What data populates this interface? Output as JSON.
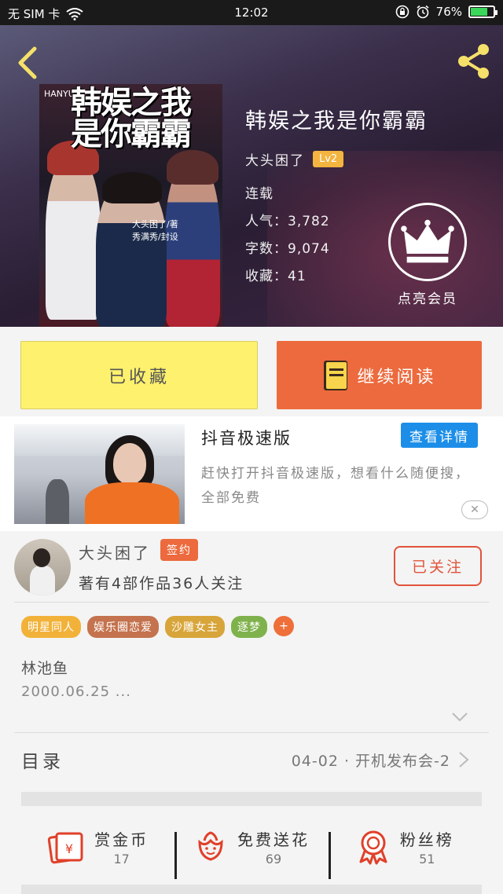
{
  "status_bar": {
    "carrier": "无 SIM 卡",
    "time": "12:02",
    "battery": "76%",
    "battery_level": 0.76
  },
  "book": {
    "title": "韩娱之我是你霸霸",
    "author": "大头困了",
    "level": "Lv2",
    "status": "连载",
    "popularity": "人气：3,782",
    "word_count": "字数：9,074",
    "favorites": "收藏：41",
    "cover": {
      "title_text": "韩娱之我是你霸霸",
      "brand": "HANYU",
      "author_credit": "大头困了/著",
      "designer_credit": "秀满秀/封设"
    }
  },
  "vip": {
    "label": "点亮会员"
  },
  "actions": {
    "collected": "已收藏",
    "continue_reading": "继续阅读"
  },
  "ad": {
    "title": "抖音极速版",
    "detail_button": "查看详情",
    "description": "赶快打开抖音极速版，想看什么随便搜，全部免费",
    "close": "✕"
  },
  "author_info": {
    "name": "大头困了",
    "badge": "签约",
    "stats": "著有4部作品36人关注",
    "follow_button": "已关注"
  },
  "tags": [
    {
      "label": "明星同人",
      "color": "#f2b23a"
    },
    {
      "label": "娱乐圈恋爱",
      "color": "#c4734e"
    },
    {
      "label": "沙雕女主",
      "color": "#d8a53a"
    },
    {
      "label": "逐梦",
      "color": "#7fb24c"
    }
  ],
  "tags_more": "+",
  "description": {
    "line1": "林池鱼",
    "line2": "2000.06.25 ..."
  },
  "toc": {
    "label": "目录",
    "latest": "04-02 · 开机发布会-2"
  },
  "rewards": [
    {
      "label": "赏金币",
      "count": "17",
      "icon": "red-envelope-icon"
    },
    {
      "label": "免费送花",
      "count": "69",
      "icon": "flower-icon"
    },
    {
      "label": "粉丝榜",
      "count": "51",
      "icon": "medal-icon"
    }
  ],
  "colors": {
    "accent_orange": "#ec6a3d",
    "collected_yellow": "#fdf16e",
    "ad_blue": "#1c8ee8",
    "level_gold": "#f4b440"
  }
}
